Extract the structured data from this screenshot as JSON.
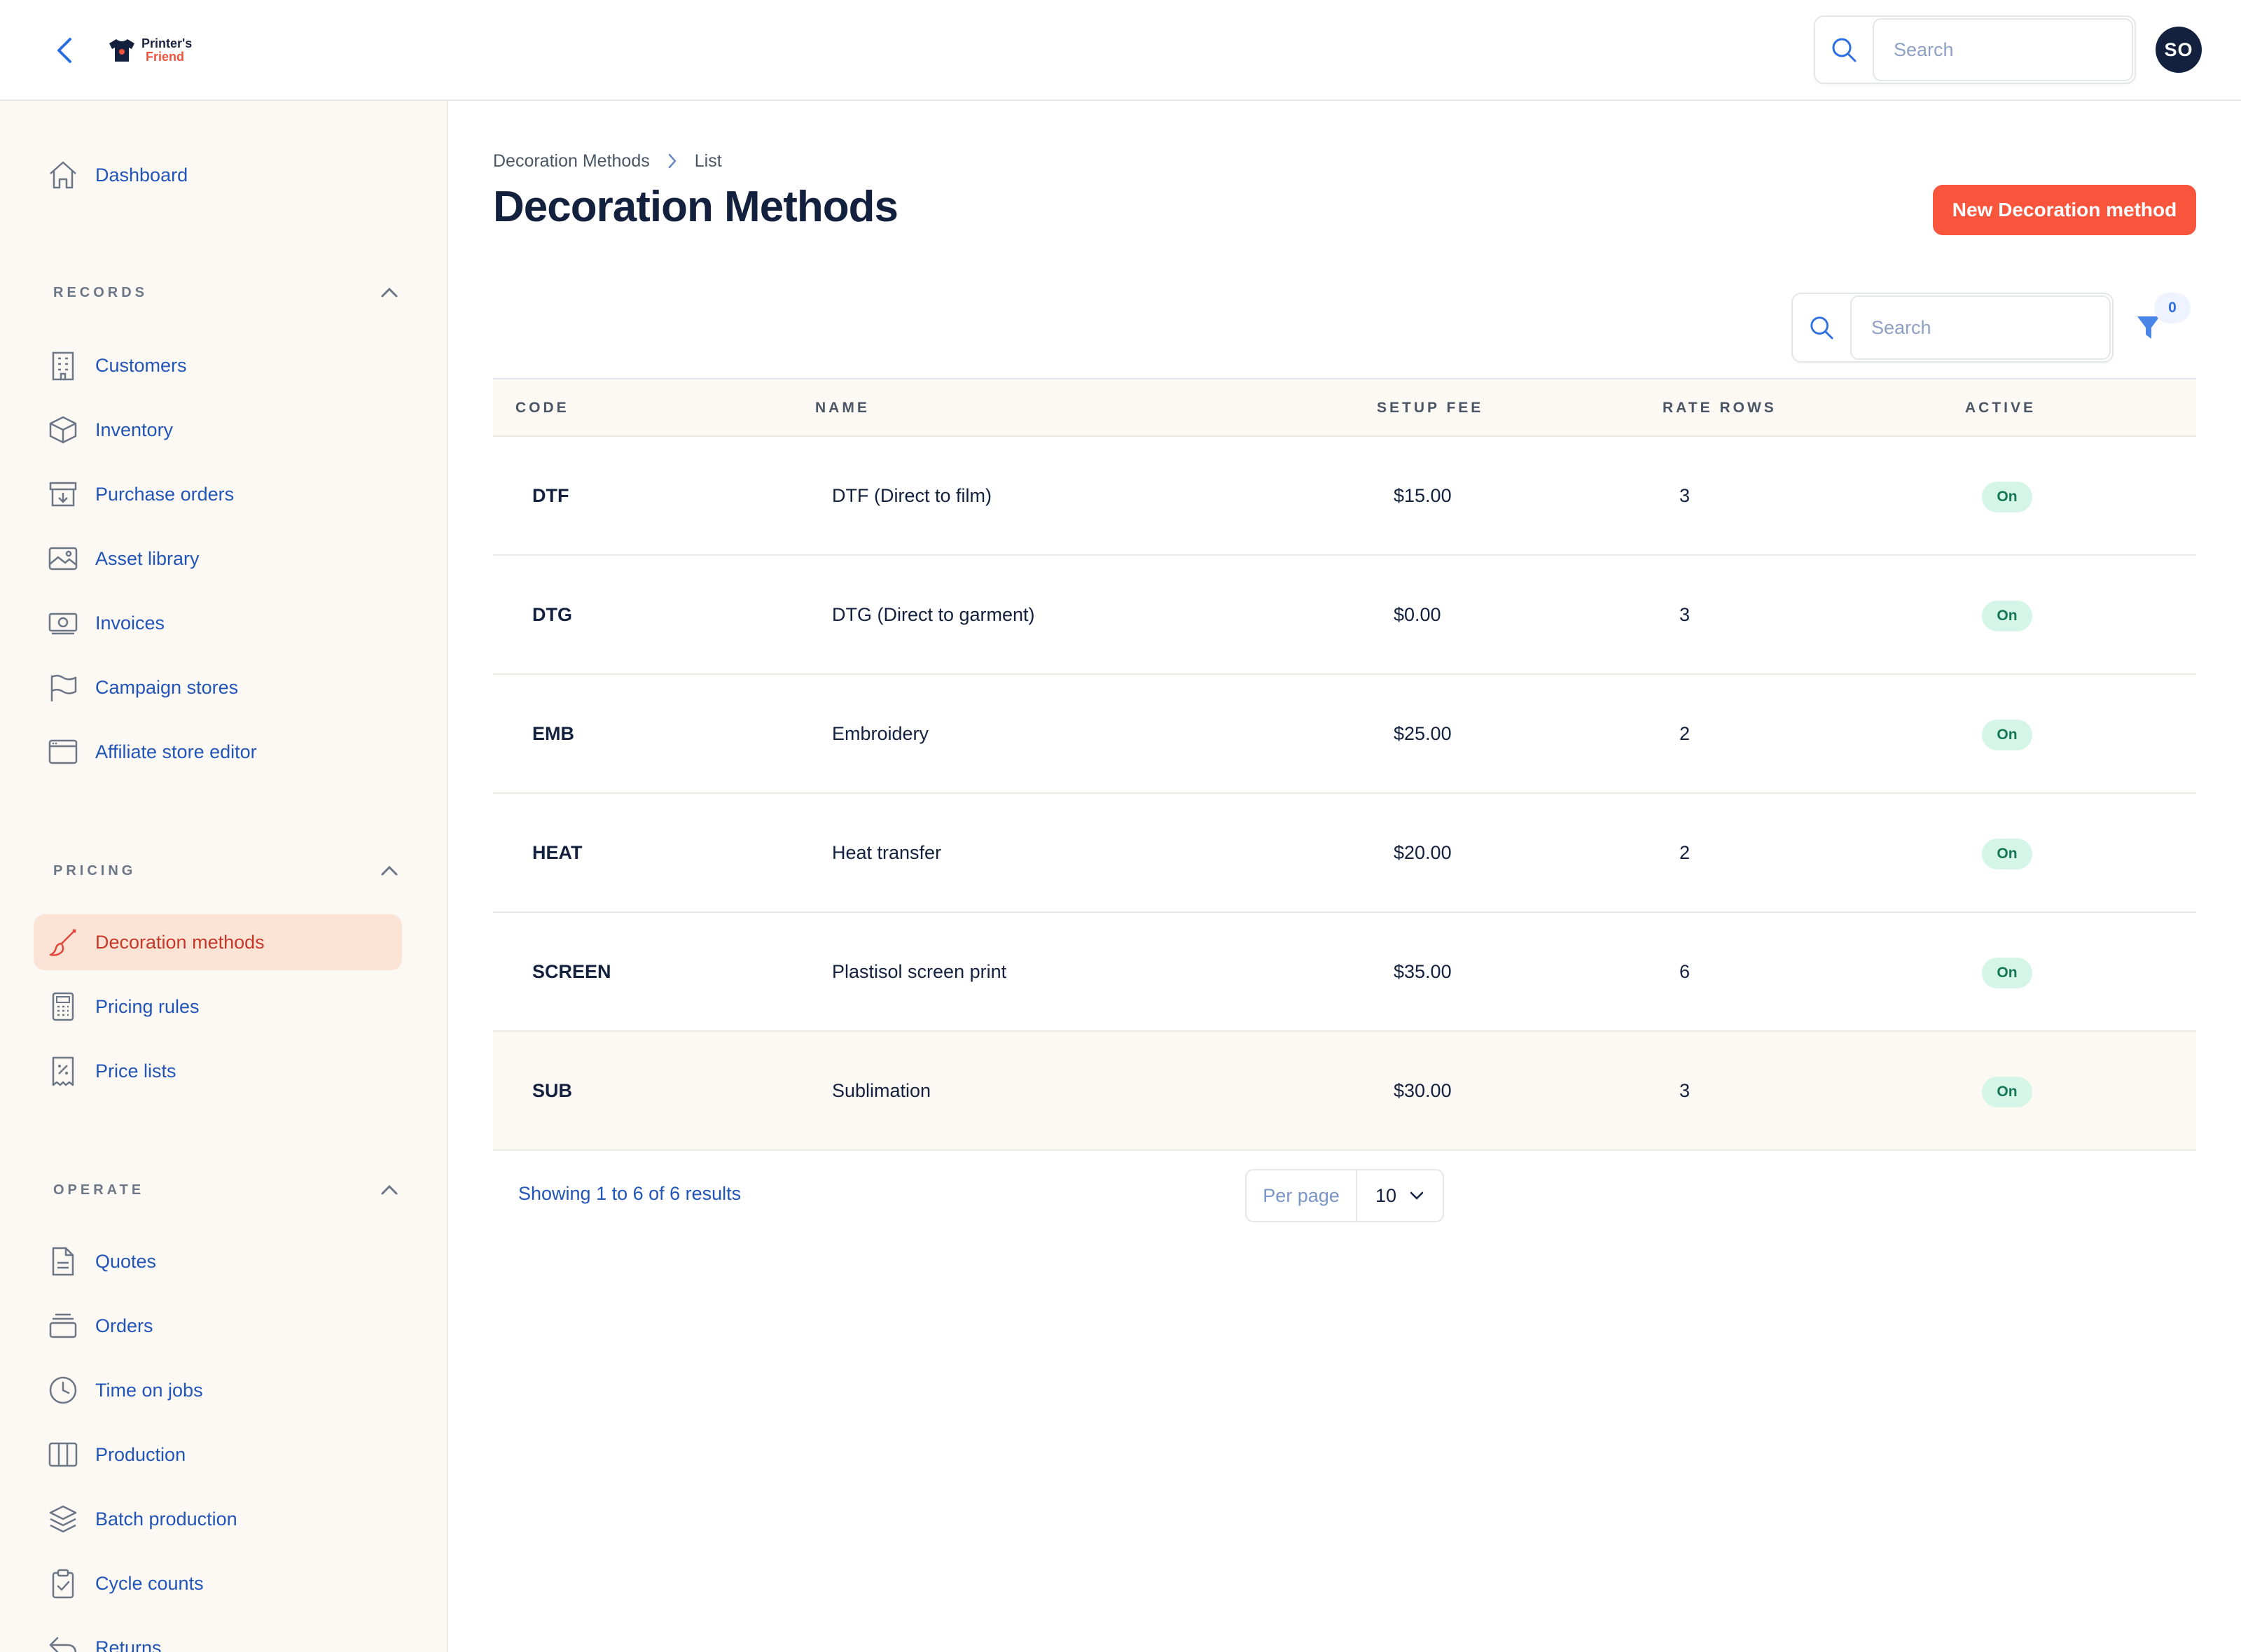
{
  "header": {
    "logo_line1": "Printer's",
    "logo_line2": "Friend",
    "search_placeholder": "Search",
    "avatar_initials": "SO"
  },
  "sidebar": {
    "dashboard": {
      "label": "Dashboard",
      "icon": "home-icon"
    },
    "sections": [
      {
        "label": "RECORDS",
        "items": [
          {
            "label": "Customers",
            "icon": "building-icon"
          },
          {
            "label": "Inventory",
            "icon": "cube-icon"
          },
          {
            "label": "Purchase orders",
            "icon": "archive-download-icon"
          },
          {
            "label": "Asset library",
            "icon": "image-icon"
          },
          {
            "label": "Invoices",
            "icon": "banknote-icon"
          },
          {
            "label": "Campaign stores",
            "icon": "flag-icon"
          },
          {
            "label": "Affiliate store editor",
            "icon": "browser-window-icon"
          }
        ]
      },
      {
        "label": "PRICING",
        "items": [
          {
            "label": "Decoration methods",
            "icon": "paintbrush-icon",
            "active": true
          },
          {
            "label": "Pricing rules",
            "icon": "calculator-icon"
          },
          {
            "label": "Price lists",
            "icon": "receipt-percent-icon"
          }
        ]
      },
      {
        "label": "OPERATE",
        "items": [
          {
            "label": "Quotes",
            "icon": "document-icon"
          },
          {
            "label": "Orders",
            "icon": "tray-stack-icon"
          },
          {
            "label": "Time on jobs",
            "icon": "clock-icon"
          },
          {
            "label": "Production",
            "icon": "columns-icon"
          },
          {
            "label": "Batch production",
            "icon": "layers-icon"
          },
          {
            "label": "Cycle counts",
            "icon": "clipboard-check-icon"
          },
          {
            "label": "Returns",
            "icon": "return-arrow-icon"
          }
        ]
      }
    ]
  },
  "main": {
    "breadcrumb": [
      "Decoration Methods",
      "List"
    ],
    "title": "Decoration Methods",
    "new_button": "New Decoration method",
    "search_placeholder": "Search",
    "filter_count": "0",
    "columns": [
      "CODE",
      "NAME",
      "SETUP FEE",
      "RATE ROWS",
      "ACTIVE"
    ],
    "rows": [
      {
        "code": "DTF",
        "name": "DTF (Direct to film)",
        "fee": "$15.00",
        "rate_rows": "3",
        "active": "On"
      },
      {
        "code": "DTG",
        "name": "DTG (Direct to garment)",
        "fee": "$0.00",
        "rate_rows": "3",
        "active": "On"
      },
      {
        "code": "EMB",
        "name": "Embroidery",
        "fee": "$25.00",
        "rate_rows": "2",
        "active": "On"
      },
      {
        "code": "HEAT",
        "name": "Heat transfer",
        "fee": "$20.00",
        "rate_rows": "2",
        "active": "On"
      },
      {
        "code": "SCREEN",
        "name": "Plastisol screen print",
        "fee": "$35.00",
        "rate_rows": "6",
        "active": "On"
      },
      {
        "code": "SUB",
        "name": "Sublimation",
        "fee": "$30.00",
        "rate_rows": "3",
        "active": "On"
      }
    ],
    "results_text": "Showing 1 to 6 of 6 results",
    "per_page_label": "Per page",
    "per_page_value": "10"
  },
  "colors": {
    "accent": "#f9553d",
    "nav_text": "#2155b8",
    "active_bg": "#fbe3d6",
    "sidebar_bg": "#fcf8f3",
    "badge_bg": "#d5f5e8",
    "badge_text": "#137654"
  }
}
